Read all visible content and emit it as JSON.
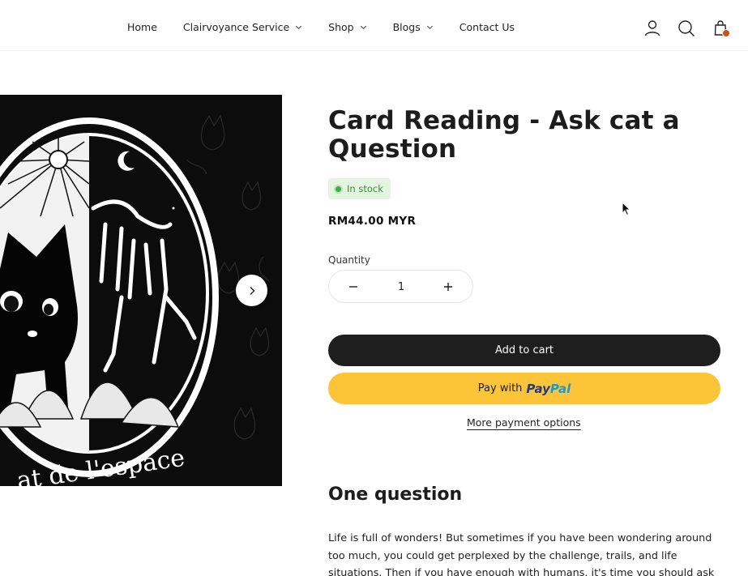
{
  "nav": {
    "items": [
      {
        "label": "Home",
        "dropdown": false
      },
      {
        "label": "Clairvoyance Service",
        "dropdown": true
      },
      {
        "label": "Shop",
        "dropdown": true
      },
      {
        "label": "Blogs",
        "dropdown": true
      },
      {
        "label": "Contact Us",
        "dropdown": false
      }
    ]
  },
  "header_icons": [
    "account-icon",
    "search-icon",
    "cart-icon"
  ],
  "product": {
    "image_caption": "at de l'espace",
    "title": "Card Reading - Ask cat a Question",
    "stock": "In stock",
    "price": "RM44.00 MYR",
    "quantity_label": "Quantity",
    "quantity": "1",
    "add_to_cart": "Add to cart",
    "pay_with": "Pay with",
    "paypal_pay": "Pay",
    "paypal_pal": "Pal",
    "more_payment": "More payment options"
  },
  "description": {
    "heading": "One question",
    "text": "Life is full of wonders! But sometimes if you have been wondering around too much, you could get perplexed by the challenge, trails, and life situations. Then if you have enough with humans, it's time you should ask"
  },
  "colors": {
    "cart_button": "#1e1e1e",
    "paypal_button": "#fcc439",
    "stock_badge_bg": "#e3f5e1",
    "stock_text": "#3d8b3a",
    "cart_dot": "#c8541c"
  }
}
